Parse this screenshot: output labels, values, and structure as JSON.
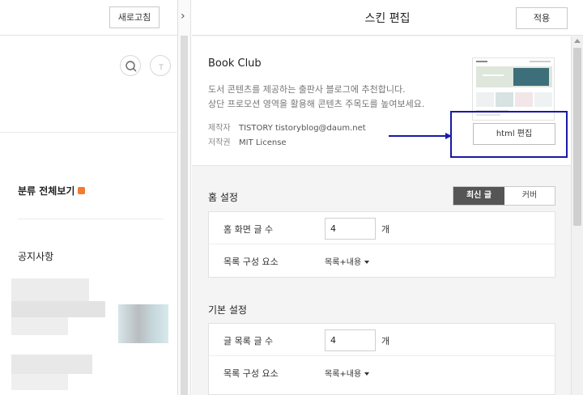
{
  "left": {
    "refresh_label": "새로고침",
    "category_label": "분류 전체보기",
    "notice_label": "공지사항"
  },
  "right": {
    "title": "스킨 편집",
    "apply_label": "적용",
    "skin": {
      "name": "Book Club",
      "desc_line1": "도서 콘텐츠를 제공하는 출판사 블로그에 추천합니다.",
      "desc_line2": "상단 프로모션 영역을 활용해 콘텐츠 주목도를 높여보세요.",
      "maker_key": "제작자",
      "maker_value": "TISTORY tistoryblog@daum.net",
      "license_key": "저작권",
      "license_value": "MIT License",
      "html_edit_label": "html 편집"
    },
    "home": {
      "title": "홈 설정",
      "tab_latest": "최신 글",
      "tab_cover": "커버",
      "count_label": "홈 화면 글 수",
      "count_value": "4",
      "count_unit": "개",
      "compose_label": "목록 구성 요소",
      "compose_value": "목록+내용"
    },
    "basic": {
      "title": "기본 설정",
      "count_label": "글 목록 글 수",
      "count_value": "4",
      "count_unit": "개",
      "compose_label": "목록 구성 요소",
      "compose_value": "목록+내용"
    }
  },
  "colors": {
    "highlight": "#1a1aa6",
    "badge": "#f37b30",
    "tab_active": "#555555"
  }
}
